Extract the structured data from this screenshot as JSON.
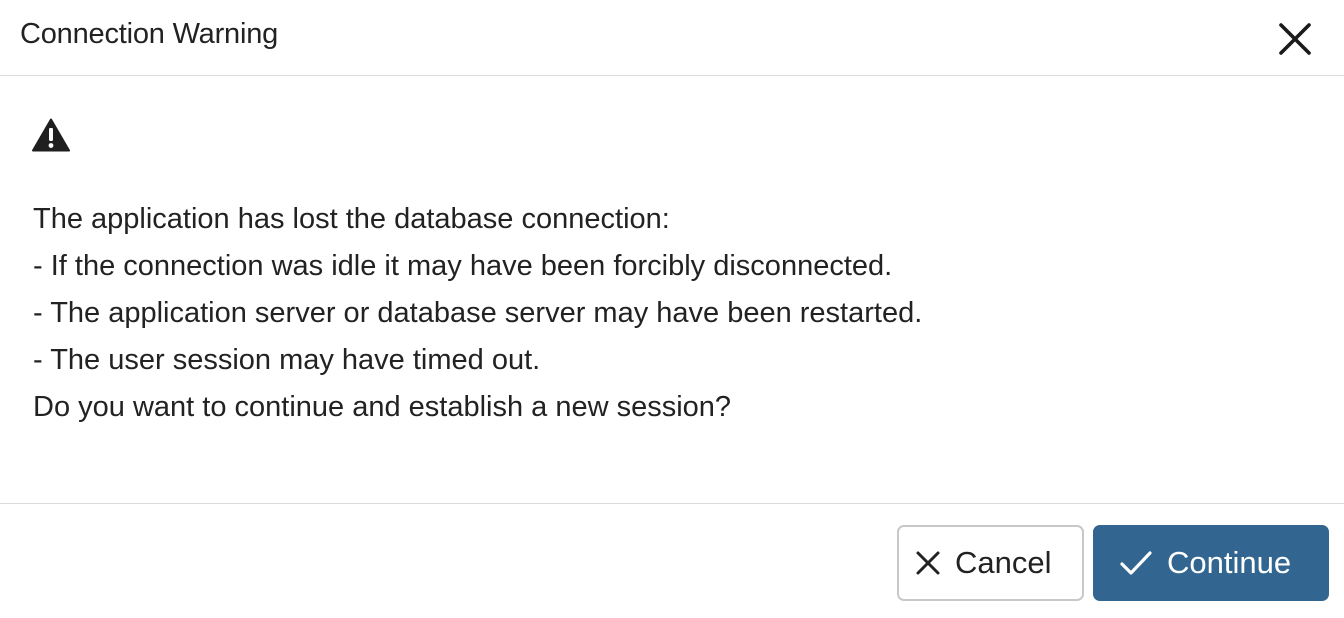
{
  "dialog": {
    "title": "Connection Warning",
    "close_icon": "close-icon",
    "warning_icon": "warning-triangle-icon",
    "message_lines": [
      "The application has lost the database connection:",
      "- If the connection was idle it may have been forcibly disconnected.",
      "- The application server or database server may have been restarted.",
      "- The user session may have timed out.",
      "Do you want to continue and establish a new session?"
    ]
  },
  "footer": {
    "cancel_label": "Cancel",
    "cancel_icon": "close-icon",
    "continue_label": "Continue",
    "continue_icon": "checkmark-icon"
  },
  "colors": {
    "primary_button": "#326690",
    "border": "#dcdcdc",
    "text": "#222222"
  }
}
